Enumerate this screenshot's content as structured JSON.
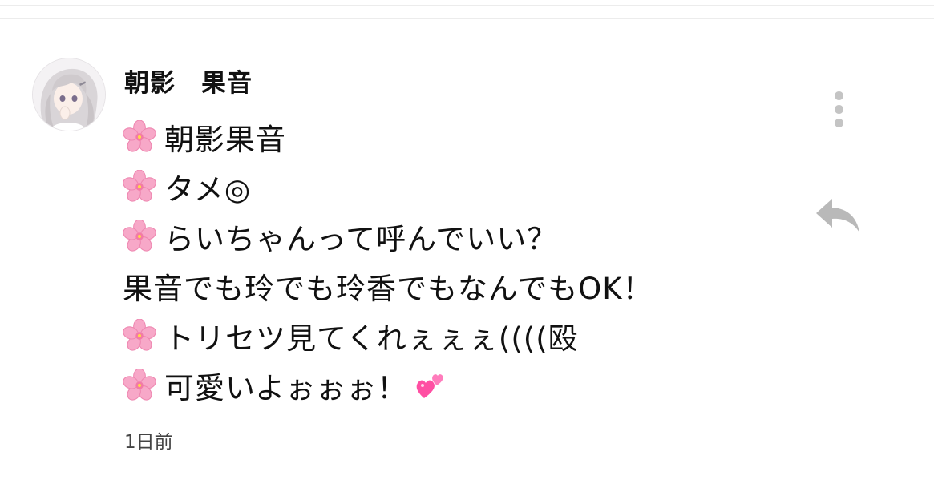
{
  "comment": {
    "author": "朝影　果音",
    "lines": [
      {
        "icon": "cherry-blossom-icon",
        "text": "朝影果音"
      },
      {
        "icon": "cherry-blossom-icon",
        "text": "タメ◎"
      },
      {
        "icon": "cherry-blossom-icon",
        "text": "らいちゃんって呼んでいい？"
      },
      {
        "icon": "",
        "text": "果音でも玲でも玲香でもなんでもOK！"
      },
      {
        "icon": "cherry-blossom-icon",
        "text": "トリセツ見てくれぇぇぇ((((殴"
      },
      {
        "icon": "cherry-blossom-icon",
        "text": "可愛いよぉぉぉ！",
        "trailing_icon": "two-hearts-icon"
      }
    ],
    "timestamp": "1日前"
  },
  "icons": {
    "more": "vertical-dots-icon",
    "reply": "reply-arrow-icon"
  },
  "colors": {
    "blossom": "#f7a8c8",
    "heart": "#ff4fa3",
    "icon_gray": "#c4c4c4",
    "timestamp": "#444444"
  }
}
